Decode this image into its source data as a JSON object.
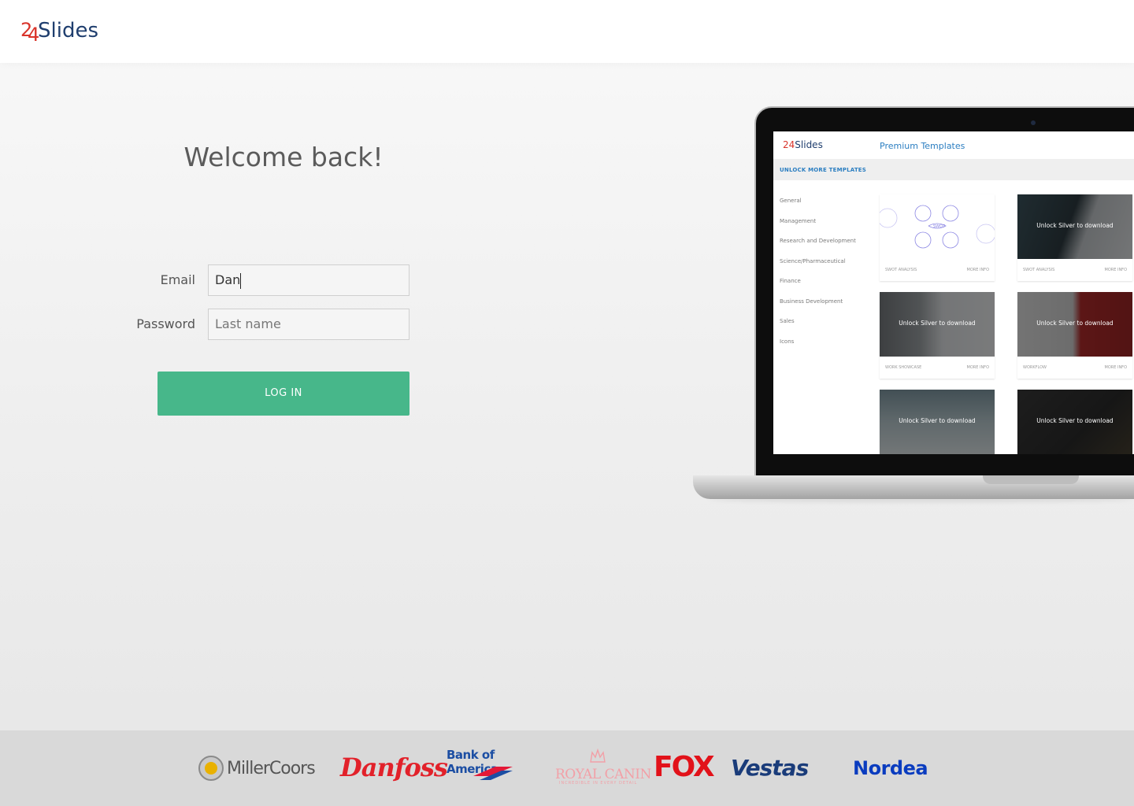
{
  "header": {
    "logo_number": "24",
    "logo_word": "Slides"
  },
  "login": {
    "title": "Welcome back!",
    "email_label": "Email",
    "email_value": "Dan",
    "password_label": "Password",
    "password_placeholder": "Last name",
    "login_button": "LOG IN"
  },
  "preview": {
    "logo_number": "24",
    "logo_word": "Slides",
    "title": "Premium Templates",
    "unlock_banner": "UNLOCK MORE TEMPLATES",
    "categories": [
      "General",
      "Management",
      "Research and Development",
      "Science/Pharmaceutical",
      "Finance",
      "Business Development",
      "Sales",
      "Icons"
    ],
    "cards": [
      {
        "caption": "SWOT ANALYSIS",
        "more": "MORE INFO",
        "overlay": ""
      },
      {
        "caption": "SWOT ANALYSIS",
        "more": "MORE INFO",
        "overlay": "Unlock Silver to download"
      },
      {
        "caption": "WORK SHOWCASE",
        "more": "MORE INFO",
        "overlay": "Unlock Silver to download"
      },
      {
        "caption": "WORKFLOW",
        "more": "MORE INFO",
        "overlay": "Unlock Silver to download"
      },
      {
        "caption": "",
        "more": "",
        "overlay": "Unlock Silver to download"
      },
      {
        "caption": "",
        "more": "",
        "overlay": "Unlock Silver to download"
      }
    ]
  },
  "clients": {
    "millercoors": "MillerCoors",
    "danfoss": "Danfoss",
    "bank_of_america": "Bank of America.",
    "royal_canin": "ROYAL CANIN",
    "royal_canin_tagline": "INCREDIBLE IN EVERY DETAIL",
    "fox": "FOX",
    "vestas": "Vestas",
    "nordea": "Nordea"
  },
  "colors": {
    "accent_green": "#47b78a",
    "logo_red": "#d9342b",
    "logo_navy": "#1f3e6e",
    "link_blue": "#2b7ec1"
  }
}
